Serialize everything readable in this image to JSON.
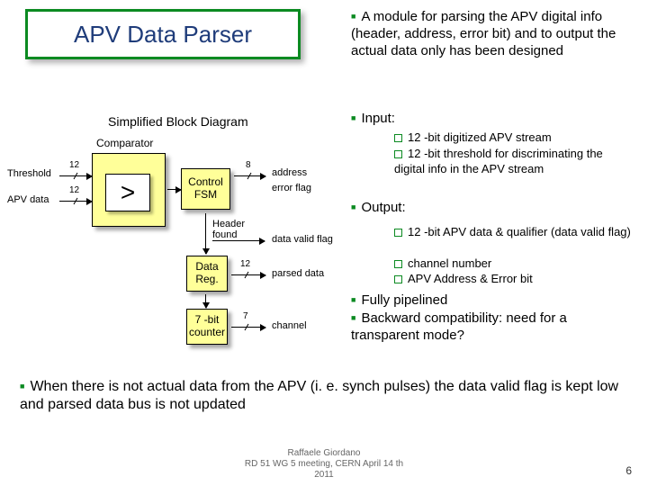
{
  "title": "APV Data Parser",
  "subtitle": "Simplified Block Diagram",
  "right": {
    "b1": "A module for parsing the APV digital info (header, address, error bit) and to output the actual data only has been designed",
    "b2": "Input:",
    "in1": "12 -bit digitized APV stream",
    "in2": "12 -bit threshold for discriminating the digital info in the APV stream",
    "b3": "Output:",
    "out1": "12 -bit APV data & qualifier (data valid flag)",
    "out2": "channel number",
    "out3": "APV Address & Error bit",
    "b4": "Fully pipelined",
    "b5": "Backward compatibility: need for a transparent mode?"
  },
  "bottom": "When there is not actual data from the APV (i. e. synch pulses) the data valid flag is kept low and parsed data bus is not updated",
  "d": {
    "comparator": "Comparator",
    "gt": ">",
    "threshold": "Threshold",
    "apvdata": "APV data",
    "w12a": "12",
    "w12b": "12",
    "ctrl": "Control FSM",
    "w8": "8",
    "sig1": "address",
    "sig2": "error flag",
    "hdr": "Header found",
    "datareg": "Data Reg.",
    "w12c": "12",
    "sig3": "data valid flag",
    "sig4": "parsed data",
    "cnt": "7 -bit counter",
    "w7": "7",
    "sig5": "channel"
  },
  "footer": {
    "l1": "Raffaele Giordano",
    "l2": "RD 51 WG 5 meeting, CERN April 14 th",
    "l3": "2011",
    "page": "6"
  }
}
